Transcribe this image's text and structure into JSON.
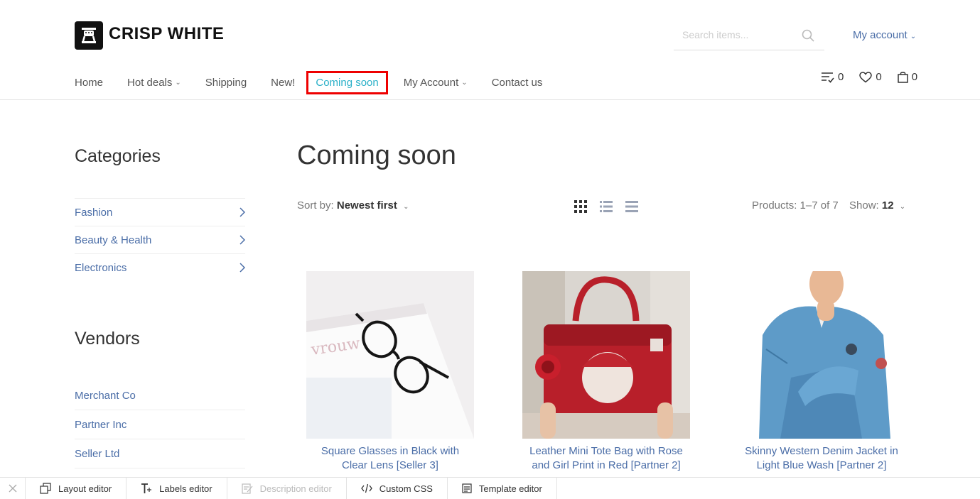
{
  "brand": {
    "name": "CRISP WHITE"
  },
  "search": {
    "placeholder": "Search items..."
  },
  "header": {
    "my_account": "My account"
  },
  "nav": [
    {
      "label": "Home",
      "dropdown": false
    },
    {
      "label": "Hot deals",
      "dropdown": true
    },
    {
      "label": "Shipping",
      "dropdown": false
    },
    {
      "label": "New!",
      "dropdown": false
    },
    {
      "label": "Coming soon",
      "dropdown": false,
      "active": true
    },
    {
      "label": "My Account",
      "dropdown": true
    },
    {
      "label": "Contact us",
      "dropdown": false
    }
  ],
  "counters": {
    "compare": "0",
    "wishlist": "0",
    "cart": "0"
  },
  "sidebar": {
    "categories_title": "Categories",
    "categories": [
      "Fashion",
      "Beauty & Health",
      "Electronics"
    ],
    "vendors_title": "Vendors",
    "vendors": [
      "Merchant Co",
      "Partner Inc",
      "Seller Ltd"
    ]
  },
  "main": {
    "title": "Coming soon",
    "sort_label": "Sort by:",
    "sort_value": "Newest first",
    "products_count": "Products: 1–7 of 7",
    "show_label": "Show:",
    "show_value": "12"
  },
  "products": [
    {
      "title_line1": "Square Glasses in Black with",
      "title_line2": "Clear Lens [Seller 3]"
    },
    {
      "title_line1": "Leather Mini Tote Bag with Rose",
      "title_line2": "and Girl Print in Red [Partner 2]"
    },
    {
      "title_line1": "Skinny Western Denim Jacket in",
      "title_line2": "Light Blue Wash [Partner 2]"
    }
  ],
  "toolbar": {
    "layout": "Layout editor",
    "labels": "Labels editor",
    "description": "Description editor",
    "css": "Custom CSS",
    "template": "Template editor"
  },
  "colors": {
    "link": "#4a6da7",
    "active": "#2ab0c8",
    "highlight": "#e00000"
  }
}
